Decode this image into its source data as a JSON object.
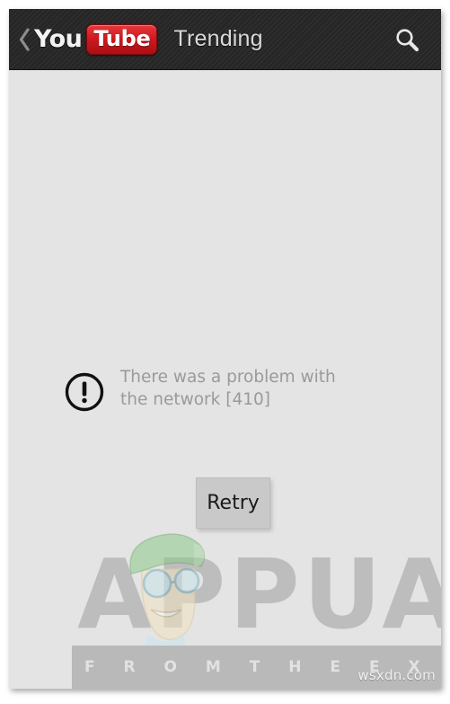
{
  "app": {
    "name": "YouTube",
    "logo_word_1": "You",
    "logo_word_2": "Tube",
    "logo_red": "#cc181e"
  },
  "header": {
    "back_icon": "chevron-left-icon",
    "title": "Trending",
    "search_icon": "search-icon",
    "background_color": "#2b2b2b",
    "title_color": "#d9d9d9"
  },
  "content": {
    "background_color": "#e4e4e4",
    "error": {
      "icon": "exclamation-circle-icon",
      "message": "There was a problem with the network [410]",
      "code": "410",
      "text_color": "#9a9a9a"
    },
    "retry_button": {
      "label": "Retry",
      "background_color": "#c9c9c9",
      "text_color": "#1a1a1a"
    }
  },
  "watermark": {
    "brand": "APPUALS",
    "tagline": "F R O M   T H E   E X P E R T S",
    "mascot": "appuals-mascot-icon",
    "brand_color": "#bdbdbd",
    "band_color": "#b9b9b9"
  },
  "credit": {
    "site": "wsxdn.com"
  }
}
